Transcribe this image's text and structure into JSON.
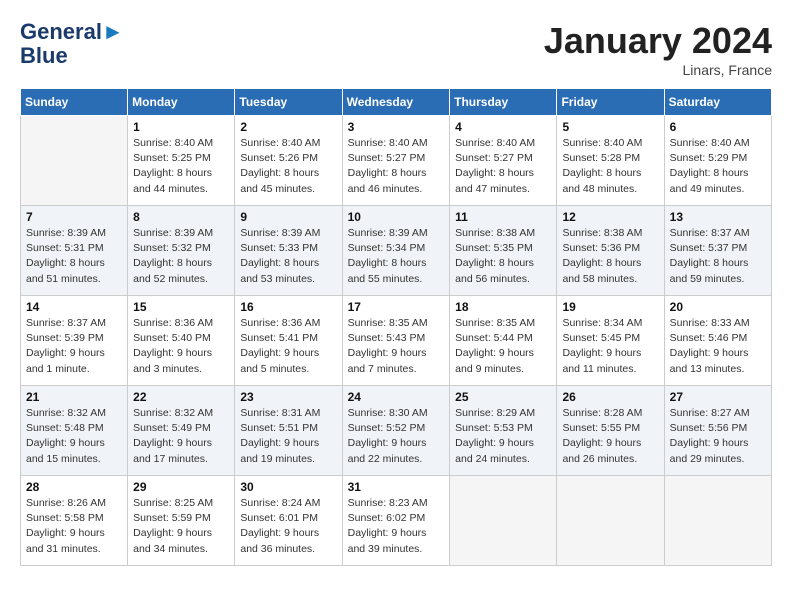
{
  "header": {
    "logo_line1": "General",
    "logo_line2": "Blue",
    "month_title": "January 2024",
    "subtitle": "Linars, France"
  },
  "weekdays": [
    "Sunday",
    "Monday",
    "Tuesday",
    "Wednesday",
    "Thursday",
    "Friday",
    "Saturday"
  ],
  "weeks": [
    [
      {
        "day": "",
        "sunrise": "",
        "sunset": "",
        "daylight": ""
      },
      {
        "day": "1",
        "sunrise": "Sunrise: 8:40 AM",
        "sunset": "Sunset: 5:25 PM",
        "daylight": "Daylight: 8 hours and 44 minutes."
      },
      {
        "day": "2",
        "sunrise": "Sunrise: 8:40 AM",
        "sunset": "Sunset: 5:26 PM",
        "daylight": "Daylight: 8 hours and 45 minutes."
      },
      {
        "day": "3",
        "sunrise": "Sunrise: 8:40 AM",
        "sunset": "Sunset: 5:27 PM",
        "daylight": "Daylight: 8 hours and 46 minutes."
      },
      {
        "day": "4",
        "sunrise": "Sunrise: 8:40 AM",
        "sunset": "Sunset: 5:27 PM",
        "daylight": "Daylight: 8 hours and 47 minutes."
      },
      {
        "day": "5",
        "sunrise": "Sunrise: 8:40 AM",
        "sunset": "Sunset: 5:28 PM",
        "daylight": "Daylight: 8 hours and 48 minutes."
      },
      {
        "day": "6",
        "sunrise": "Sunrise: 8:40 AM",
        "sunset": "Sunset: 5:29 PM",
        "daylight": "Daylight: 8 hours and 49 minutes."
      }
    ],
    [
      {
        "day": "7",
        "sunrise": "Sunrise: 8:39 AM",
        "sunset": "Sunset: 5:31 PM",
        "daylight": "Daylight: 8 hours and 51 minutes."
      },
      {
        "day": "8",
        "sunrise": "Sunrise: 8:39 AM",
        "sunset": "Sunset: 5:32 PM",
        "daylight": "Daylight: 8 hours and 52 minutes."
      },
      {
        "day": "9",
        "sunrise": "Sunrise: 8:39 AM",
        "sunset": "Sunset: 5:33 PM",
        "daylight": "Daylight: 8 hours and 53 minutes."
      },
      {
        "day": "10",
        "sunrise": "Sunrise: 8:39 AM",
        "sunset": "Sunset: 5:34 PM",
        "daylight": "Daylight: 8 hours and 55 minutes."
      },
      {
        "day": "11",
        "sunrise": "Sunrise: 8:38 AM",
        "sunset": "Sunset: 5:35 PM",
        "daylight": "Daylight: 8 hours and 56 minutes."
      },
      {
        "day": "12",
        "sunrise": "Sunrise: 8:38 AM",
        "sunset": "Sunset: 5:36 PM",
        "daylight": "Daylight: 8 hours and 58 minutes."
      },
      {
        "day": "13",
        "sunrise": "Sunrise: 8:37 AM",
        "sunset": "Sunset: 5:37 PM",
        "daylight": "Daylight: 8 hours and 59 minutes."
      }
    ],
    [
      {
        "day": "14",
        "sunrise": "Sunrise: 8:37 AM",
        "sunset": "Sunset: 5:39 PM",
        "daylight": "Daylight: 9 hours and 1 minute."
      },
      {
        "day": "15",
        "sunrise": "Sunrise: 8:36 AM",
        "sunset": "Sunset: 5:40 PM",
        "daylight": "Daylight: 9 hours and 3 minutes."
      },
      {
        "day": "16",
        "sunrise": "Sunrise: 8:36 AM",
        "sunset": "Sunset: 5:41 PM",
        "daylight": "Daylight: 9 hours and 5 minutes."
      },
      {
        "day": "17",
        "sunrise": "Sunrise: 8:35 AM",
        "sunset": "Sunset: 5:43 PM",
        "daylight": "Daylight: 9 hours and 7 minutes."
      },
      {
        "day": "18",
        "sunrise": "Sunrise: 8:35 AM",
        "sunset": "Sunset: 5:44 PM",
        "daylight": "Daylight: 9 hours and 9 minutes."
      },
      {
        "day": "19",
        "sunrise": "Sunrise: 8:34 AM",
        "sunset": "Sunset: 5:45 PM",
        "daylight": "Daylight: 9 hours and 11 minutes."
      },
      {
        "day": "20",
        "sunrise": "Sunrise: 8:33 AM",
        "sunset": "Sunset: 5:46 PM",
        "daylight": "Daylight: 9 hours and 13 minutes."
      }
    ],
    [
      {
        "day": "21",
        "sunrise": "Sunrise: 8:32 AM",
        "sunset": "Sunset: 5:48 PM",
        "daylight": "Daylight: 9 hours and 15 minutes."
      },
      {
        "day": "22",
        "sunrise": "Sunrise: 8:32 AM",
        "sunset": "Sunset: 5:49 PM",
        "daylight": "Daylight: 9 hours and 17 minutes."
      },
      {
        "day": "23",
        "sunrise": "Sunrise: 8:31 AM",
        "sunset": "Sunset: 5:51 PM",
        "daylight": "Daylight: 9 hours and 19 minutes."
      },
      {
        "day": "24",
        "sunrise": "Sunrise: 8:30 AM",
        "sunset": "Sunset: 5:52 PM",
        "daylight": "Daylight: 9 hours and 22 minutes."
      },
      {
        "day": "25",
        "sunrise": "Sunrise: 8:29 AM",
        "sunset": "Sunset: 5:53 PM",
        "daylight": "Daylight: 9 hours and 24 minutes."
      },
      {
        "day": "26",
        "sunrise": "Sunrise: 8:28 AM",
        "sunset": "Sunset: 5:55 PM",
        "daylight": "Daylight: 9 hours and 26 minutes."
      },
      {
        "day": "27",
        "sunrise": "Sunrise: 8:27 AM",
        "sunset": "Sunset: 5:56 PM",
        "daylight": "Daylight: 9 hours and 29 minutes."
      }
    ],
    [
      {
        "day": "28",
        "sunrise": "Sunrise: 8:26 AM",
        "sunset": "Sunset: 5:58 PM",
        "daylight": "Daylight: 9 hours and 31 minutes."
      },
      {
        "day": "29",
        "sunrise": "Sunrise: 8:25 AM",
        "sunset": "Sunset: 5:59 PM",
        "daylight": "Daylight: 9 hours and 34 minutes."
      },
      {
        "day": "30",
        "sunrise": "Sunrise: 8:24 AM",
        "sunset": "Sunset: 6:01 PM",
        "daylight": "Daylight: 9 hours and 36 minutes."
      },
      {
        "day": "31",
        "sunrise": "Sunrise: 8:23 AM",
        "sunset": "Sunset: 6:02 PM",
        "daylight": "Daylight: 9 hours and 39 minutes."
      },
      {
        "day": "",
        "sunrise": "",
        "sunset": "",
        "daylight": ""
      },
      {
        "day": "",
        "sunrise": "",
        "sunset": "",
        "daylight": ""
      },
      {
        "day": "",
        "sunrise": "",
        "sunset": "",
        "daylight": ""
      }
    ]
  ]
}
